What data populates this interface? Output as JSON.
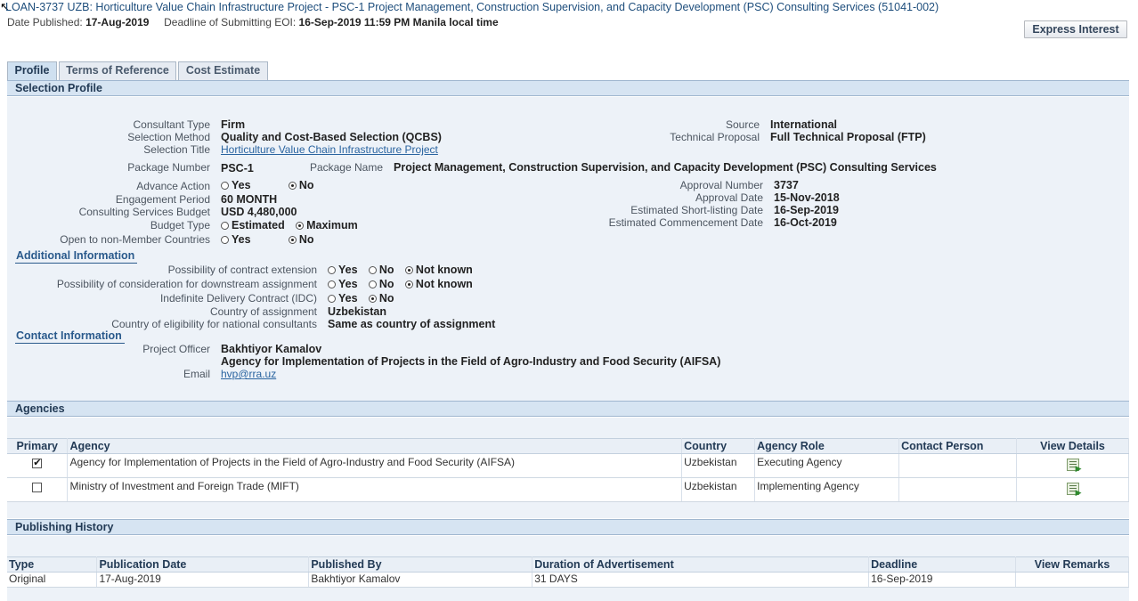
{
  "header": {
    "title": "LOAN-3737 UZB: Horticulture Value Chain Infrastructure Project - PSC-1 Project Management, Construction Supervision, and Capacity Development (PSC) Consulting Services (51041-002)",
    "date_published_label": "Date Published:",
    "date_published": "17-Aug-2019",
    "deadline_label": "Deadline of Submitting EOI:",
    "deadline": "16-Sep-2019 11:59 PM Manila local time",
    "express_interest": "Express Interest"
  },
  "tabs": [
    {
      "label": "Profile",
      "active": true
    },
    {
      "label": "Terms of Reference",
      "active": false
    },
    {
      "label": "Cost Estimate",
      "active": false
    }
  ],
  "selection_profile": {
    "heading": "Selection Profile",
    "consultant_type_label": "Consultant Type",
    "consultant_type": "Firm",
    "selection_method_label": "Selection Method",
    "selection_method": "Quality and Cost-Based Selection (QCBS)",
    "selection_title_label": "Selection Title",
    "selection_title": "Horticulture Value Chain Infrastructure Project",
    "source_label": "Source",
    "source": "International",
    "technical_proposal_label": "Technical Proposal",
    "technical_proposal": "Full Technical Proposal (FTP)",
    "package_number_label": "Package Number",
    "package_number": "PSC-1",
    "package_name_label": "Package Name",
    "package_name": "Project Management, Construction Supervision, and Capacity Development (PSC) Consulting Services",
    "advance_action_label": "Advance Action",
    "advance_action_yes": "Yes",
    "advance_action_no": "No",
    "advance_action_selected": "No",
    "engagement_period_label": "Engagement Period",
    "engagement_period": "60 MONTH",
    "budget_label": "Consulting Services Budget",
    "budget": "USD 4,480,000",
    "budget_type_label": "Budget Type",
    "budget_type_estimated": "Estimated",
    "budget_type_maximum": "Maximum",
    "budget_type_selected": "Maximum",
    "open_label": "Open to non-Member Countries",
    "open_yes": "Yes",
    "open_no": "No",
    "open_selected": "No",
    "approval_number_label": "Approval Number",
    "approval_number": "3737",
    "approval_date_label": "Approval Date",
    "approval_date": "15-Nov-2018",
    "shortlisting_label": "Estimated Short-listing Date",
    "shortlisting": "16-Sep-2019",
    "commencement_label": "Estimated Commencement Date",
    "commencement": "16-Oct-2019"
  },
  "additional_info": {
    "heading": "Additional Information",
    "extension_label": "Possibility of contract extension",
    "downstream_label": "Possibility of consideration for downstream assignment",
    "idc_label": "Indefinite Delivery Contract (IDC)",
    "opt_yes": "Yes",
    "opt_no": "No",
    "opt_not_known": "Not known",
    "extension_selected": "Not known",
    "downstream_selected": "Not known",
    "idc_selected": "No",
    "country_label": "Country of assignment",
    "country": "Uzbekistan",
    "eligibility_label": "Country of eligibility for national consultants",
    "eligibility": "Same as country of assignment"
  },
  "contact_info": {
    "heading": "Contact Information",
    "officer_label": "Project Officer",
    "officer": "Bakhtiyor Kamalov",
    "agency": "Agency for Implementation of Projects in the Field of Agro-Industry and Food Security (AIFSA)",
    "email_label": "Email",
    "email": "hvp@rra.uz"
  },
  "agencies": {
    "heading": "Agencies",
    "columns": [
      "Primary",
      "Agency",
      "Country",
      "Agency Role",
      "Contact Person",
      "View Details"
    ],
    "rows": [
      {
        "primary": true,
        "agency": "Agency for Implementation of Projects in the Field of Agro-Industry and Food Security (AIFSA)",
        "country": "Uzbekistan",
        "role": "Executing Agency",
        "contact": ""
      },
      {
        "primary": false,
        "agency": "Ministry of Investment and Foreign Trade (MIFT)",
        "country": "Uzbekistan",
        "role": "Implementing Agency",
        "contact": ""
      }
    ]
  },
  "publishing_history": {
    "heading": "Publishing History",
    "columns": [
      "Type",
      "Publication Date",
      "Published By",
      "Duration of Advertisement",
      "Deadline",
      "View Remarks"
    ],
    "rows": [
      {
        "type": "Original",
        "date": "17-Aug-2019",
        "by": "Bakhtiyor Kamalov",
        "duration": "31 DAYS",
        "deadline": "16-Sep-2019",
        "remarks": ""
      }
    ]
  },
  "colors": {
    "header_bar": "#d6e4f2",
    "panel": "#edf2f8",
    "link": "#2a64a0",
    "title": "#1e4e7c"
  }
}
